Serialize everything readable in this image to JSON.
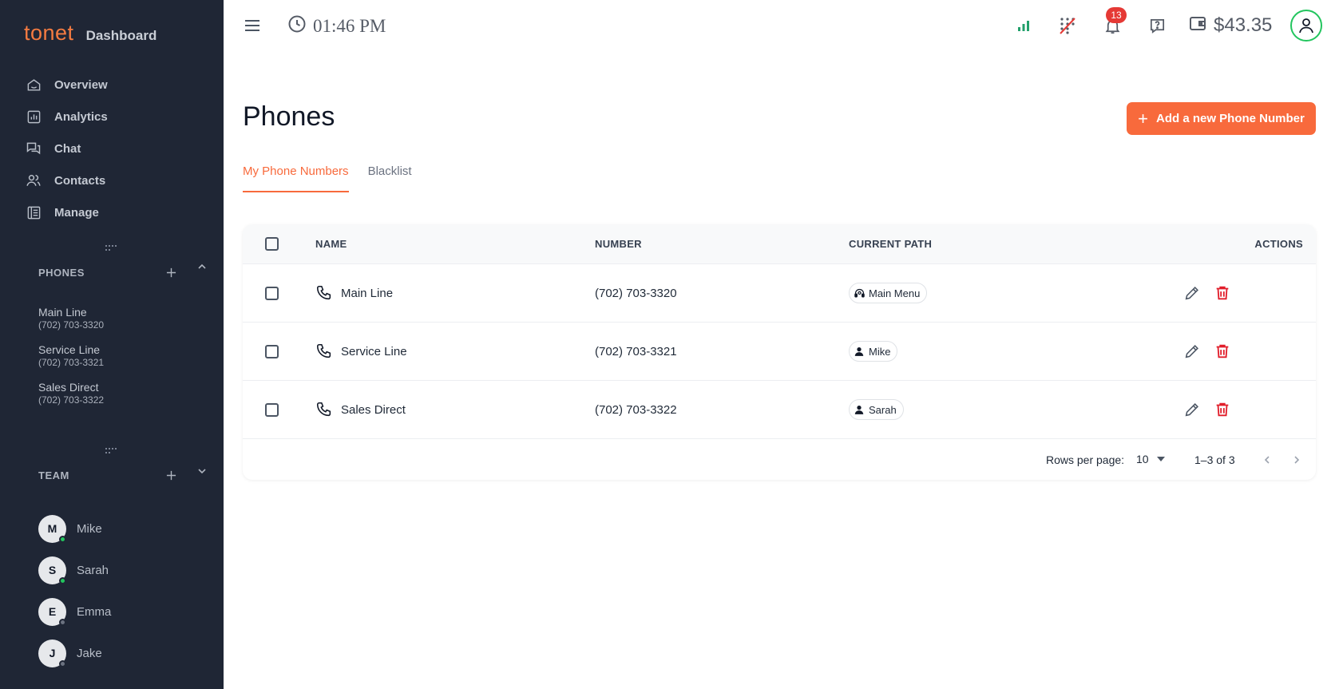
{
  "brand": {
    "logo": "tonet",
    "subtitle": "Dashboard"
  },
  "nav": [
    {
      "label": "Overview",
      "icon": "home-icon"
    },
    {
      "label": "Analytics",
      "icon": "analytics-icon"
    },
    {
      "label": "Chat",
      "icon": "chat-icon"
    },
    {
      "label": "Contacts",
      "icon": "contacts-icon"
    },
    {
      "label": "Manage",
      "icon": "manage-icon"
    }
  ],
  "phones_section": {
    "title": "PHONES",
    "items": [
      {
        "name": "Main Line",
        "number": "(702) 703-3320"
      },
      {
        "name": "Service Line",
        "number": "(702) 703-3321"
      },
      {
        "name": "Sales Direct",
        "number": "(702) 703-3322"
      }
    ]
  },
  "team_section": {
    "title": "TEAM",
    "members": [
      {
        "initial": "M",
        "name": "Mike",
        "status": "online",
        "status_color": "#22c55e"
      },
      {
        "initial": "S",
        "name": "Sarah",
        "status": "online",
        "status_color": "#22c55e"
      },
      {
        "initial": "E",
        "name": "Emma",
        "status": "offline",
        "status_color": "#6b7280"
      },
      {
        "initial": "J",
        "name": "Jake",
        "status": "offline",
        "status_color": "#6b7280"
      }
    ]
  },
  "topbar": {
    "time": "01:46 PM",
    "notification_count": "13",
    "balance": "$43.35"
  },
  "page": {
    "title": "Phones",
    "add_button": "Add a new Phone Number",
    "tabs": [
      {
        "label": "My Phone Numbers",
        "active": true
      },
      {
        "label": "Blacklist",
        "active": false
      }
    ]
  },
  "table": {
    "columns": {
      "name": "NAME",
      "number": "NUMBER",
      "path": "CURRENT PATH",
      "actions": "ACTIONS"
    },
    "rows": [
      {
        "name": "Main Line",
        "number": "(702) 703-3320",
        "path": "Main Menu",
        "path_icon": "ivr-menu-icon"
      },
      {
        "name": "Service Line",
        "number": "(702) 703-3321",
        "path": "Mike",
        "path_icon": "person-icon"
      },
      {
        "name": "Sales Direct",
        "number": "(702) 703-3322",
        "path": "Sarah",
        "path_icon": "person-icon"
      }
    ],
    "footer": {
      "rows_per_page_label": "Rows per page:",
      "rows_per_page": "10",
      "range": "1–3 of 3"
    }
  },
  "colors": {
    "accent": "#f86a3c",
    "sidebar_bg": "#1f2635",
    "delete": "#e11d2a",
    "online": "#22c55e",
    "badge": "#e53935"
  }
}
